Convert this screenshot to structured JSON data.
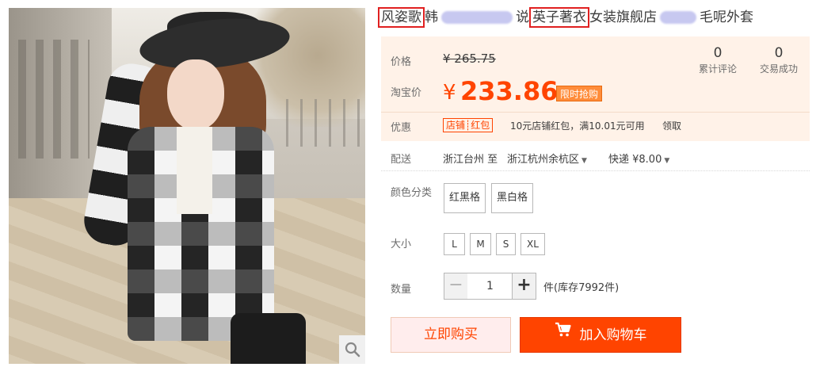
{
  "title": {
    "brand_highlight": "风姿歌",
    "part1": "韩",
    "part2": "说",
    "shop_highlight": "英子著衣",
    "part3": "女装旗舰店",
    "part4": "毛呢外套"
  },
  "price": {
    "orig_label": "价格",
    "orig_value": "¥ 265.75",
    "sale_label": "淘宝价",
    "currency": "¥",
    "sale_value": "233.86",
    "promo_badge": "限时抢购"
  },
  "stats": [
    {
      "value": "0",
      "label": "累计评论"
    },
    {
      "value": "0",
      "label": "交易成功"
    }
  ],
  "coupon": {
    "label": "优惠",
    "tag": "店铺┊红包",
    "text": "10元店铺红包，满10.01元可用",
    "link": "领取"
  },
  "shipping": {
    "label": "配送",
    "from": "浙江台州 至",
    "to": "浙江杭州余杭区",
    "method": "快递 ¥8.00"
  },
  "color": {
    "label": "颜色分类",
    "options": [
      "红黑格",
      "黑白格"
    ]
  },
  "size": {
    "label": "大小",
    "options": [
      "L",
      "M",
      "S",
      "XL"
    ]
  },
  "quantity": {
    "label": "数量",
    "minus": "−",
    "value": "1",
    "plus": "+",
    "stock": "件(库存7992件)"
  },
  "actions": {
    "buy_now": "立即购买",
    "add_cart": "加入购物车"
  },
  "colors": {
    "accent": "#ff4400",
    "price_bg": "#fff2e8",
    "highlight_border": "#e02020"
  }
}
